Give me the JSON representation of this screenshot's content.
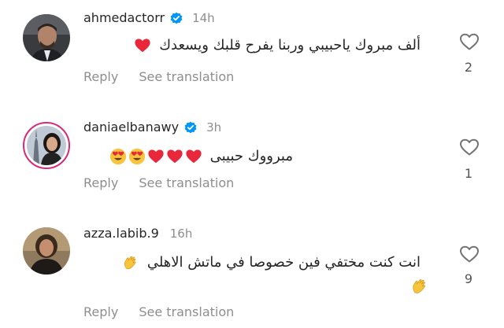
{
  "comments": [
    {
      "username": "ahmedactorr",
      "verified": true,
      "time": "14h",
      "text": "ألف مبروك ياحبيبي وربنا يفرح قلبك ويسعدك",
      "emojis": [
        "red-heart"
      ],
      "reply_label": "Reply",
      "translate_label": "See translation",
      "likes": "2"
    },
    {
      "username": "daniaelbanawy",
      "verified": true,
      "time": "3h",
      "text": "مبرووك حبيبى",
      "emojis": [
        "red-heart",
        "red-heart",
        "red-heart",
        "heart-eyes",
        "heart-eyes"
      ],
      "reply_label": "Reply",
      "translate_label": "See translation",
      "likes": "1"
    },
    {
      "username": "azza.labib.9",
      "verified": false,
      "time": "16h",
      "text": "انت كنت مختفي فين  خصوصا في ماتش الاهلي",
      "emojis": [
        "clapping-hands",
        "clapping-hands"
      ],
      "reply_label": "Reply",
      "translate_label": "See translation",
      "likes": "9"
    }
  ],
  "colors": {
    "verified_badge": "#0095f6",
    "heart": "#e8273b",
    "muted_text": "#8e8e8e",
    "story_ring": "#d62a7a"
  }
}
